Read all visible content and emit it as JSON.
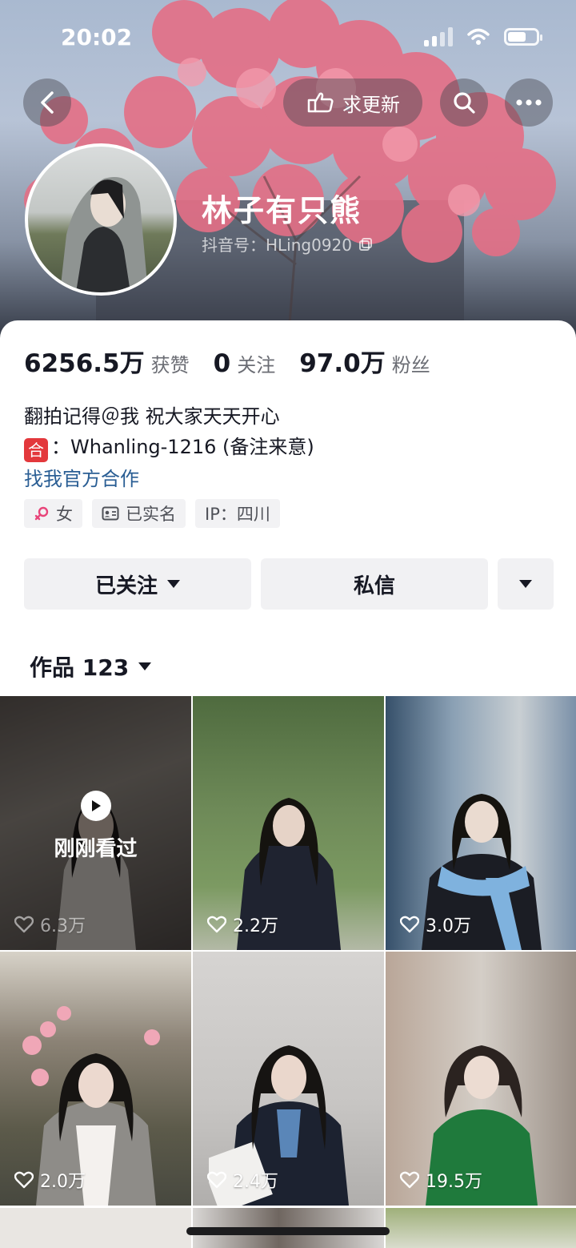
{
  "status_bar": {
    "time": "20:02"
  },
  "header": {
    "request_update_label": "求更新",
    "nickname": "林子有只熊",
    "douyin_id": "抖音号：HLing0920"
  },
  "stats": [
    {
      "value": "6256.5万",
      "label": "获赞"
    },
    {
      "value": "0",
      "label": "关注"
    },
    {
      "value": "97.0万",
      "label": "粉丝"
    }
  ],
  "bio": {
    "line1": "翻拍记得＠我 祝大家天天开心",
    "he_badge": "合",
    "line2": "：Whanling-1216 (备注来意)",
    "official_link": "找我官方合作"
  },
  "tags": {
    "gender": "女",
    "verified": "已实名",
    "ip": "IP：四川"
  },
  "actions": {
    "followed": "已关注",
    "message": "私信"
  },
  "works": {
    "label": "作品 123"
  },
  "videos": [
    {
      "likes": "6.3万",
      "watched_label": "刚刚看过"
    },
    {
      "likes": "2.2万"
    },
    {
      "likes": "3.0万"
    },
    {
      "likes": "2.0万"
    },
    {
      "likes": "2.4万"
    },
    {
      "likes": "19.5万"
    }
  ],
  "colors": {
    "link": "#2a5e94",
    "he_badge": "#e3383c",
    "female_icon": "#e8457a"
  }
}
